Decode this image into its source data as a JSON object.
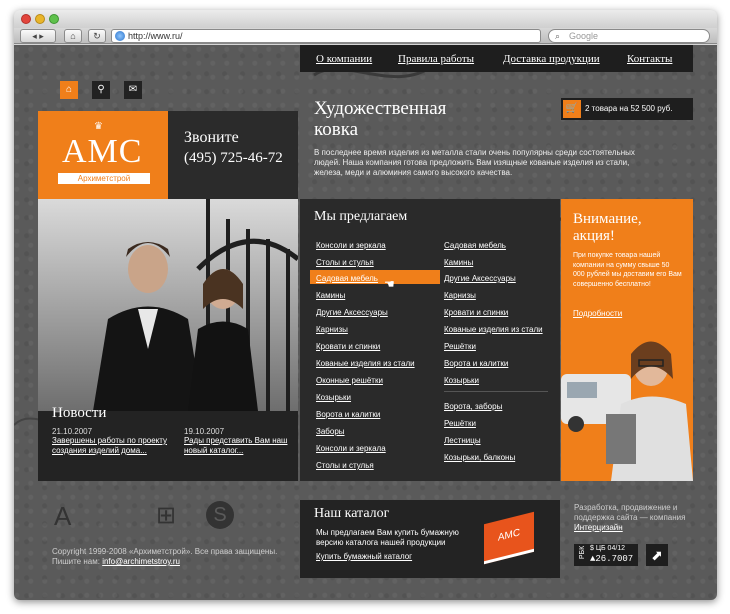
{
  "browser": {
    "url": "http://www.ru/",
    "search_placeholder": "Google"
  },
  "nav": {
    "items": [
      "О компании",
      "Правила работы",
      "Доставка продукции",
      "Контакты"
    ]
  },
  "cart": {
    "text": "2 товара на 52 500 руб."
  },
  "hero": {
    "title_line1": "Художественная",
    "title_line2": "ковка",
    "description": "В последнее время изделия из металла стали очень популярны среди состоятельных людей. Наша компания готова предложить Вам изящные кованые изделия из стали, железа, меди и алюминия самого высокого качества."
  },
  "logo": {
    "text": "AMC",
    "subtitle": "Архиметстрой"
  },
  "call": {
    "label": "Звоните",
    "phone": "(495) 725-46-72"
  },
  "news": {
    "title": "Новости",
    "items": [
      {
        "date": "21.10.2007",
        "text": "Завершены работы по проекту создания изделий дома..."
      },
      {
        "date": "19.10.2007",
        "text": "Рады представить Вам наш новый каталог..."
      }
    ]
  },
  "offer": {
    "title": "Мы предлагаем",
    "left_items": [
      "Консоли и зеркала",
      "Столы и стулья",
      "Садовая мебель",
      "Камины",
      "Другие Аксессуары",
      "Карнизы",
      "Кровати и спинки",
      "Кованые изделия из стали",
      "Оконные решётки",
      "Козырьки",
      "Ворота и калитки",
      "Заборы",
      "Консоли и зеркала",
      "Столы и стулья"
    ],
    "right_items": [
      "Садовая мебель",
      "Камины",
      "Другие Аксессуары",
      "Карнизы",
      "Кровати и спинки",
      "Кованые изделия из стали",
      "Решётки",
      "Ворота и калитки",
      "Козырьки",
      "Ворота, заборы",
      "Решётки",
      "Лестницы",
      "Козырьки, балконы"
    ],
    "highlighted": "Садовая мебель"
  },
  "promo": {
    "title_line1": "Внимание,",
    "title_line2": "акция!",
    "text": "При покупке товара нашей компании на сумму свыше 50 000 рублей мы доставим его Вам совершенно бесплатно!",
    "link": "Подробности"
  },
  "catalog": {
    "title": "Наш каталог",
    "text": "Мы предлагаем Вам купить бумажную версию каталога нашей продукции",
    "link": "Купить бумажный каталог",
    "book_label": "АМС"
  },
  "footer": {
    "copyright": "Copyright 1999-2008 «Архиметстрой». Все права защищены.",
    "write_label": "Пишите нам:",
    "email": "info@archimetstroy.ru",
    "dev_text": "Разработка, продвижение и поддержка сайта — компания",
    "dev_company": "Интерцизайн",
    "rbk_label": "РБК",
    "rbk_rate_label": "$ ЦБ 04/12",
    "rbk_rate": "▲26.7007"
  },
  "colors": {
    "accent": "#f07f1a",
    "panel": "#232323"
  }
}
